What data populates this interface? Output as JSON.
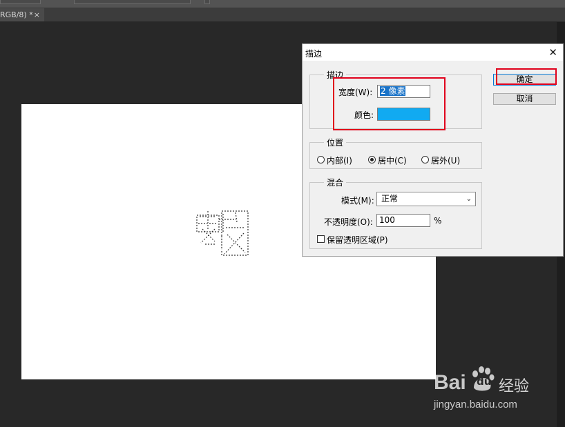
{
  "tab": {
    "title": "RGB/8) *",
    "close": "×"
  },
  "dialog": {
    "title": "描边",
    "close": "✕",
    "stroke_group": {
      "legend": "描边",
      "width_label": "宽度(W):",
      "width_value": "2 像素",
      "color_label": "颜色:",
      "color_value": "#11aaf1"
    },
    "position_group": {
      "legend": "位置",
      "options": [
        "内部(I)",
        "居中(C)",
        "居外(U)"
      ],
      "selected": "居中(C)"
    },
    "blend_group": {
      "legend": "混合",
      "mode_label": "模式(M):",
      "mode_value": "正常",
      "opacity_label": "不透明度(O):",
      "opacity_value": "100",
      "opacity_unit": "%",
      "preserve_label": "保留透明区域(P)",
      "preserve_checked": false
    },
    "buttons": {
      "ok": "确定",
      "cancel": "取消"
    }
  },
  "watermark": {
    "brand": "Bai",
    "brand2": "du",
    "product": "经验",
    "url": "jingyan.baidu.com"
  }
}
